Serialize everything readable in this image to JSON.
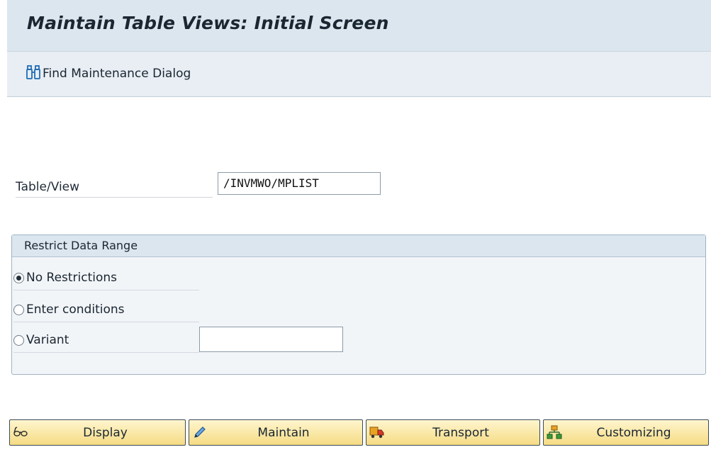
{
  "window": {
    "title": "Maintain Table Views: Initial Screen"
  },
  "toolbar": {
    "find_label": "Find Maintenance Dialog",
    "find_icon": "binoculars-icon"
  },
  "form": {
    "table_view_label": "Table/View",
    "table_view_value": "/INVMWO/MPLIST"
  },
  "restrict": {
    "title": "Restrict Data Range",
    "options": [
      {
        "label": "No Restrictions",
        "checked": true
      },
      {
        "label": "Enter conditions",
        "checked": false
      },
      {
        "label": "Variant",
        "checked": false
      }
    ],
    "variant_value": ""
  },
  "actions": {
    "display_label": "Display",
    "maintain_label": "Maintain",
    "transport_label": "Transport",
    "customizing_label": "Customizing"
  },
  "colors": {
    "title_bar": "#dce6ee",
    "toolbar": "#e8eef3",
    "button_top": "#fff6cf",
    "button_bottom": "#f5db83",
    "icon_blue": "#1f6bb5"
  }
}
